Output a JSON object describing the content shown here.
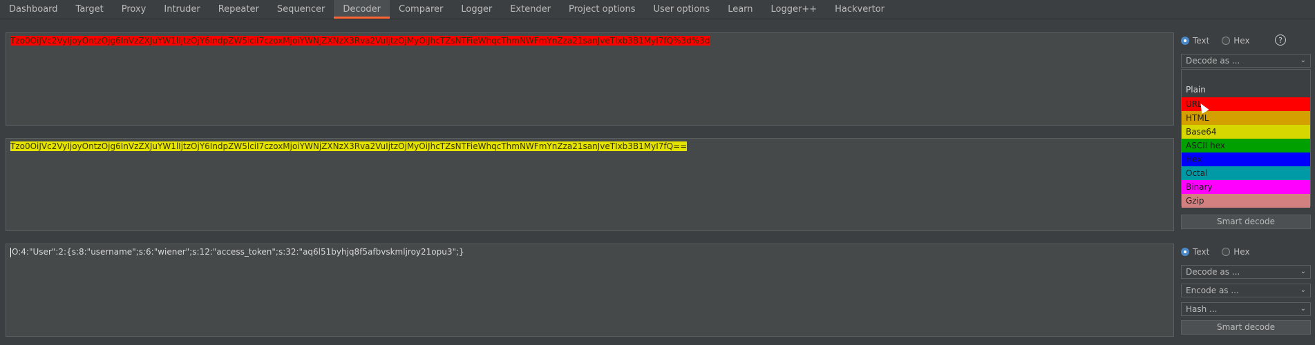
{
  "tabs": [
    {
      "label": "Dashboard"
    },
    {
      "label": "Target"
    },
    {
      "label": "Proxy"
    },
    {
      "label": "Intruder"
    },
    {
      "label": "Repeater"
    },
    {
      "label": "Sequencer"
    },
    {
      "label": "Decoder"
    },
    {
      "label": "Comparer"
    },
    {
      "label": "Logger"
    },
    {
      "label": "Extender"
    },
    {
      "label": "Project options"
    },
    {
      "label": "User options"
    },
    {
      "label": "Learn"
    },
    {
      "label": "Logger++"
    },
    {
      "label": "Hackvertor"
    }
  ],
  "active_tab": "Decoder",
  "panel1": {
    "text": "Tzo0OiJVc2VyIjoyOntzOjg6InVzZXJuYW1lIjtzOjY6IndpZW5lciI7czoxMjoiYWNjZXNzX3Rva2VuIjtzOjMyOiJhcTZsNTFieWhqcThmNWFmYnZza21sanJveTIxb3B1MyI7fQ%3d%3d",
    "radio_text": "Text",
    "radio_hex": "Hex",
    "help": "?",
    "decode_select": "Decode as ...",
    "dropdown_items": [
      {
        "label": "Plain",
        "color": ""
      },
      {
        "label": "URL",
        "color": "#ff0000"
      },
      {
        "label": "HTML",
        "color": "#d4a000"
      },
      {
        "label": "Base64",
        "color": "#d7d700"
      },
      {
        "label": "ASCII hex",
        "color": "#00a000"
      },
      {
        "label": "Hex",
        "color": "#0000ff"
      },
      {
        "label": "Octal",
        "color": "#009aa6"
      },
      {
        "label": "Binary",
        "color": "#ff00ff"
      },
      {
        "label": "Gzip",
        "color": "#d38080"
      }
    ],
    "highlight_color": "#ff0000"
  },
  "panel2": {
    "text": "Tzo0OiJVc2VyIjoyOntzOjg6InVzZXJuYW1lIjtzOjY6IndpZW5lciI7czoxMjoiYWNjZXNzX3Rva2VuIjtzOjMyOiJhcTZsNTFieWhqcThmNWFmYnZza21sanJveTIxb3B1MyI7fQ==",
    "smart_decode": "Smart decode",
    "highlight_color": "#e4e400"
  },
  "panel3": {
    "text": "O:4:\"User\":2:{s:8:\"username\";s:6:\"wiener\";s:12:\"access_token\";s:32:\"aq6l51byhjq8f5afbvskmljroy21opu3\";}",
    "radio_text": "Text",
    "radio_hex": "Hex",
    "decode_select": "Decode as ...",
    "encode_select": "Encode as ...",
    "hash_select": "Hash ...",
    "smart_decode": "Smart decode"
  },
  "accent_color": "#ff6633"
}
